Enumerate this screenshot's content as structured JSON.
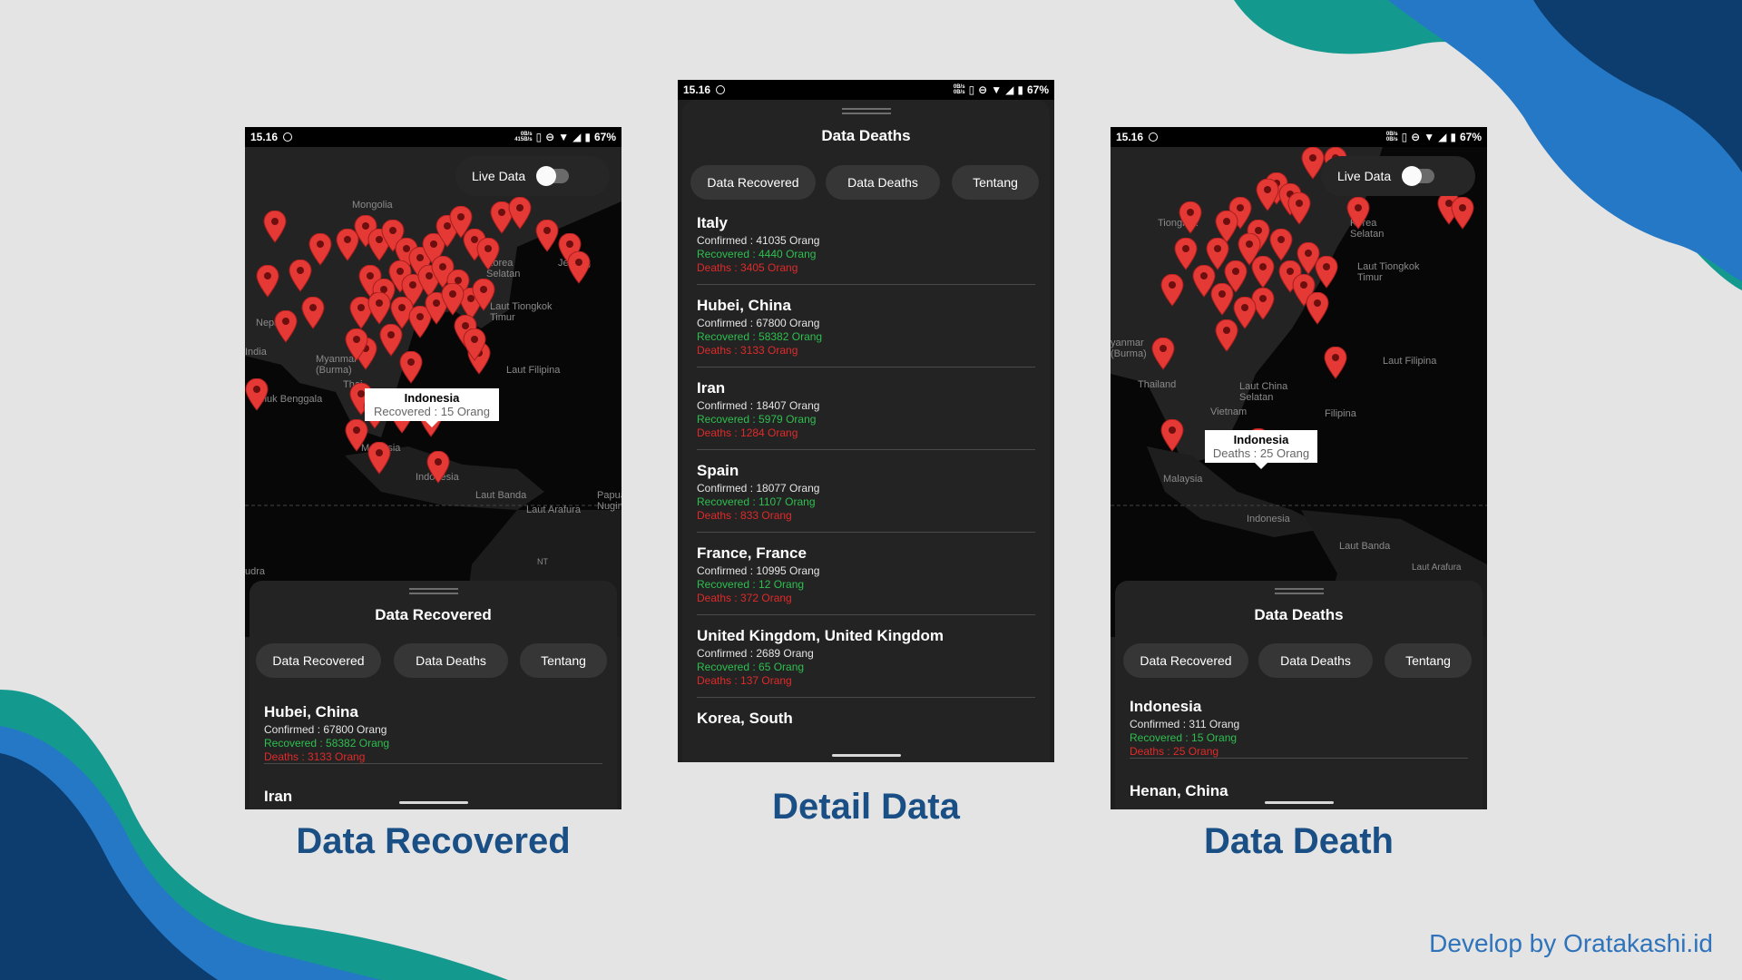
{
  "colors": {
    "background": "#e4e4e4",
    "caption": "#1a4f86",
    "credit": "#2f73bb",
    "teal": "#14998f",
    "navy": "#0d3d6e",
    "blue": "#2478c6"
  },
  "credit": "Develop by Oratakashi.id",
  "status_bar": {
    "time": "15.16",
    "speed_top": "0B/s",
    "battery": "67%"
  },
  "phones": [
    {
      "caption": "Data Recovered",
      "speed_bottom": "415B/s",
      "live_data_label": "Live Data",
      "tooltip": {
        "title": "Indonesia",
        "value": "Recovered : 15 Orang"
      },
      "map_labels": [
        "Mongolia",
        "Korea Selatan",
        "Jepang",
        "Nepal",
        "Myanmar (Burma)",
        "Thai",
        "Laut Tiongkok Timur",
        "Laut Filipina",
        "Teluk Benggala",
        "Malaysia",
        "Indonesia",
        "Laut Banda",
        "Laut Arafura",
        "Papua Nugini",
        "NT",
        "India",
        "udra"
      ],
      "sheet_title": "Data Recovered",
      "chips": [
        "Data Recovered",
        "Data Deaths",
        "Tentang"
      ],
      "items": [
        {
          "name": "Hubei, China",
          "confirmed": "Confirmed : 67800 Orang",
          "recovered": "Recovered : 58382 Orang",
          "deaths": "Deaths : 3133 Orang"
        },
        {
          "name": "Iran",
          "confirmed": "",
          "recovered": "",
          "deaths": ""
        }
      ]
    },
    {
      "caption": "Detail Data",
      "speed_bottom": "0B/s",
      "sheet_title": "Data Deaths",
      "chips": [
        "Data Recovered",
        "Data Deaths",
        "Tentang"
      ],
      "items": [
        {
          "name": "Italy",
          "confirmed": "Confirmed : 41035 Orang",
          "recovered": "Recovered : 4440 Orang",
          "deaths": "Deaths : 3405 Orang"
        },
        {
          "name": "Hubei, China",
          "confirmed": "Confirmed : 67800 Orang",
          "recovered": "Recovered : 58382 Orang",
          "deaths": "Deaths : 3133 Orang"
        },
        {
          "name": "Iran",
          "confirmed": "Confirmed : 18407 Orang",
          "recovered": "Recovered : 5979 Orang",
          "deaths": "Deaths : 1284 Orang"
        },
        {
          "name": "Spain",
          "confirmed": "Confirmed : 18077 Orang",
          "recovered": "Recovered : 1107 Orang",
          "deaths": "Deaths : 833 Orang"
        },
        {
          "name": "France, France",
          "confirmed": "Confirmed : 10995 Orang",
          "recovered": "Recovered : 12 Orang",
          "deaths": "Deaths : 372 Orang"
        },
        {
          "name": "United Kingdom, United Kingdom",
          "confirmed": "Confirmed : 2689 Orang",
          "recovered": "Recovered : 65 Orang",
          "deaths": "Deaths : 137 Orang"
        },
        {
          "name": "Korea, South",
          "confirmed": "",
          "recovered": "",
          "deaths": ""
        }
      ]
    },
    {
      "caption": "Data Death",
      "speed_bottom": "0B/s",
      "live_data_label": "Live Data",
      "tooltip": {
        "title": "Indonesia",
        "value": "Deaths : 25 Orang"
      },
      "map_labels": [
        "Tiongkok",
        "Korea Selatan",
        "Laut Tiongkok Timur",
        "yanmar (Burma)",
        "Thailand",
        "Laut China Selatan",
        "Vietnam",
        "Filipina",
        "Laut Filipina",
        "Malaysia",
        "Indonesia",
        "Laut Banda",
        "Laut Arafura"
      ],
      "sheet_title": "Data Deaths",
      "chips": [
        "Data Recovered",
        "Data Deaths",
        "Tentang"
      ],
      "items": [
        {
          "name": "Indonesia",
          "confirmed": "Confirmed : 311 Orang",
          "recovered": "Recovered : 15 Orang",
          "deaths": "Deaths : 25 Orang"
        },
        {
          "name": "Henan, China",
          "confirmed": "",
          "recovered": "",
          "deaths": ""
        }
      ]
    }
  ]
}
